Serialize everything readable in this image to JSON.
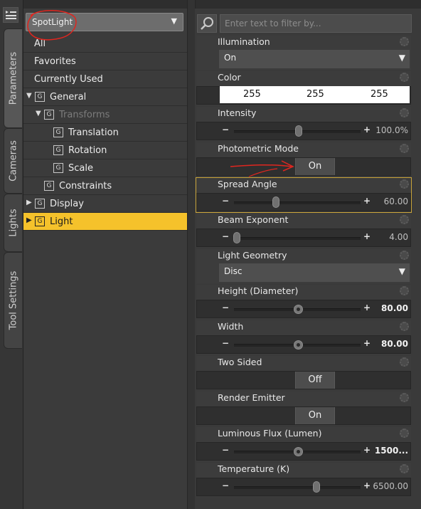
{
  "tabs": [
    "Parameters",
    "Cameras",
    "Lights",
    "Tool Settings"
  ],
  "preset": {
    "value": "SpotLight"
  },
  "tree": [
    {
      "label": "All",
      "indent": 0,
      "icon": false,
      "toggle": ""
    },
    {
      "label": "Favorites",
      "indent": 0,
      "icon": false,
      "toggle": ""
    },
    {
      "label": "Currently Used",
      "indent": 0,
      "icon": false,
      "toggle": ""
    },
    {
      "label": "General",
      "indent": 1,
      "icon": true,
      "toggle": "▼"
    },
    {
      "label": "Transforms",
      "indent": 2,
      "icon": true,
      "toggle": "▼"
    },
    {
      "label": "Translation",
      "indent": 3,
      "icon": true,
      "toggle": ""
    },
    {
      "label": "Rotation",
      "indent": 3,
      "icon": true,
      "toggle": ""
    },
    {
      "label": "Scale",
      "indent": 3,
      "icon": true,
      "toggle": ""
    },
    {
      "label": "Constraints",
      "indent": 2,
      "icon": true,
      "toggle": ""
    },
    {
      "label": "Display",
      "indent": 1,
      "icon": true,
      "toggle": "▶"
    },
    {
      "label": "Light",
      "indent": 1,
      "icon": true,
      "toggle": "▶"
    }
  ],
  "tree_selected": "Light",
  "tree_dim": "Transforms",
  "search": {
    "placeholder": "Enter text to filter by..."
  },
  "params": {
    "illumination": {
      "title": "Illumination",
      "value": "On"
    },
    "color": {
      "title": "Color",
      "r": "255",
      "g": "255",
      "b": "255"
    },
    "intensity": {
      "title": "Intensity",
      "value": "100.0%",
      "fraction": 0.51
    },
    "photometric": {
      "title": "Photometric Mode",
      "value": "On"
    },
    "spread": {
      "title": "Spread Angle",
      "value": "60.00",
      "fraction": 0.33
    },
    "beam": {
      "title": "Beam Exponent",
      "value": "4.00",
      "fraction": 0.02
    },
    "geometry": {
      "title": "Light Geometry",
      "value": "Disc"
    },
    "height": {
      "title": "Height (Diameter)",
      "value": "80.00",
      "fraction": 0.51
    },
    "width": {
      "title": "Width",
      "value": "80.00",
      "fraction": 0.51
    },
    "twosided": {
      "title": "Two Sided",
      "value": "Off"
    },
    "emitter": {
      "title": "Render Emitter",
      "value": "On"
    },
    "flux": {
      "title": "Luminous Flux (Lumen)",
      "value": "1500...",
      "fraction": 0.51
    },
    "temperature": {
      "title": "Temperature (K)",
      "value": "6500.00",
      "fraction": 0.65
    }
  },
  "colors": {
    "selection": "#f5c22b",
    "annotation": "#e0261f"
  }
}
